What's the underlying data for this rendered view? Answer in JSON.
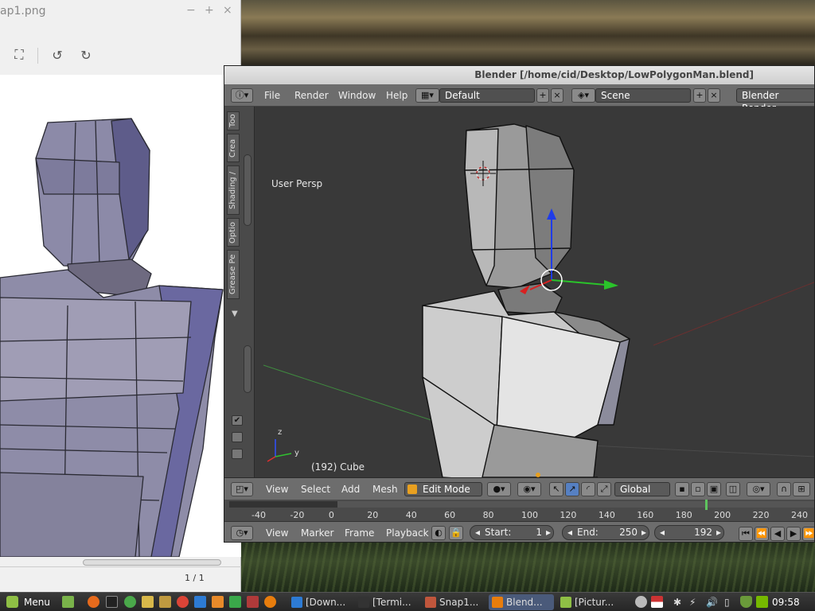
{
  "viewer": {
    "title": "ap1.png",
    "controls": {
      "minimize": "−",
      "maximize": "+",
      "close": "×"
    },
    "tools": {
      "fit": "⛶",
      "rotate_left": "↺",
      "rotate_right": "↻"
    },
    "page_count": "1 / 1"
  },
  "blender": {
    "title": "Blender [/home/cid/Desktop/LowPolygonMan.blend]",
    "menu": [
      "File",
      "Render",
      "Window",
      "Help"
    ],
    "screen_layout": "Default",
    "scene": "Scene",
    "render_engine": "Blender Render",
    "tool_tabs": [
      "Too",
      "Crea",
      "Shading /",
      "Optio",
      "Grease Pe"
    ],
    "viewport": {
      "view_label": "User Persp",
      "object_label": "(192) Cube",
      "axis_z": "z",
      "axis_y": "y"
    },
    "header3d": {
      "menu": [
        "View",
        "Select",
        "Add",
        "Mesh"
      ],
      "mode": "Edit Mode",
      "orientation": "Global"
    },
    "timeline": {
      "ticks": [
        "-40",
        "-20",
        "0",
        "20",
        "40",
        "60",
        "80",
        "100",
        "120",
        "140",
        "160",
        "180",
        "200",
        "220",
        "240"
      ],
      "current_frame": 192
    },
    "timeline_header": {
      "menu": [
        "View",
        "Marker",
        "Frame",
        "Playback"
      ],
      "start_label": "Start:",
      "start": "1",
      "end_label": "End:",
      "end": "250",
      "current": "192"
    }
  },
  "taskbar": {
    "menu_label": "Menu",
    "tasks": [
      {
        "label": "[Down...",
        "color": "#2d7bd4"
      },
      {
        "label": "[Termi...",
        "color": "#333333"
      },
      {
        "label": "Snap1...",
        "color": "#c0563c"
      },
      {
        "label": "Blend...",
        "color": "#e87d0d"
      },
      {
        "label": "[Pictur...",
        "color": "#8fbf45"
      }
    ],
    "clock": "09:58"
  },
  "colors": {
    "blender_orange": "#e87d0d",
    "mint_green": "#8fbf45"
  }
}
